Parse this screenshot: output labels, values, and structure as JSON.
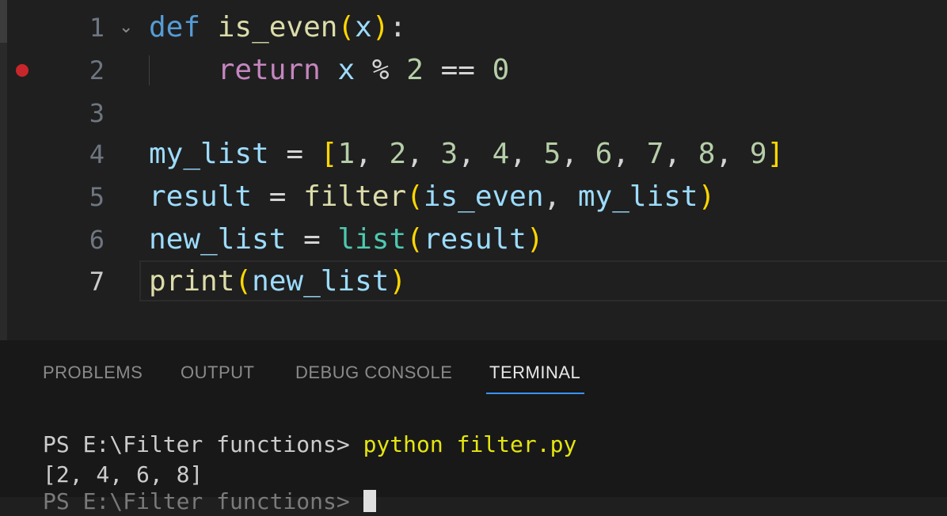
{
  "editor": {
    "lines": [
      {
        "number": "1",
        "text": "def is_even(x):"
      },
      {
        "number": "2",
        "text": "    return x % 2 == 0"
      },
      {
        "number": "3",
        "text": ""
      },
      {
        "number": "4",
        "text": "my_list = [1, 2, 3, 4, 5, 6, 7, 8, 9]"
      },
      {
        "number": "5",
        "text": "result = filter(is_even, my_list)"
      },
      {
        "number": "6",
        "text": "new_list = list(result)"
      },
      {
        "number": "7",
        "text": "print(new_list)"
      }
    ],
    "active_line": "7",
    "breakpoint_line": "2",
    "fold_icon": "chevron-down-icon"
  },
  "panel": {
    "tabs": [
      "PROBLEMS",
      "OUTPUT",
      "DEBUG CONSOLE",
      "TERMINAL"
    ],
    "active_tab": "TERMINAL",
    "terminal": {
      "prompt": "PS E:\\Filter functions> ",
      "command": "python filter.py",
      "output": "[2, 4, 6, 8]",
      "next_prompt": "PS E:\\Filter functions> "
    }
  },
  "colors": {
    "background": "#1f1f1f",
    "panel_background": "#181818",
    "keyword": "#569cd6",
    "control_keyword": "#c586c0",
    "function": "#dcdcaa",
    "variable": "#9cdcfe",
    "number": "#b5cea8",
    "builtin": "#4ec9b0",
    "bracket_level_1": "#ffd700",
    "bracket_level_2": "#da70d6",
    "terminal_command": "#e5e510",
    "active_tab_underline": "#3794ff",
    "breakpoint": "#c8262b"
  }
}
